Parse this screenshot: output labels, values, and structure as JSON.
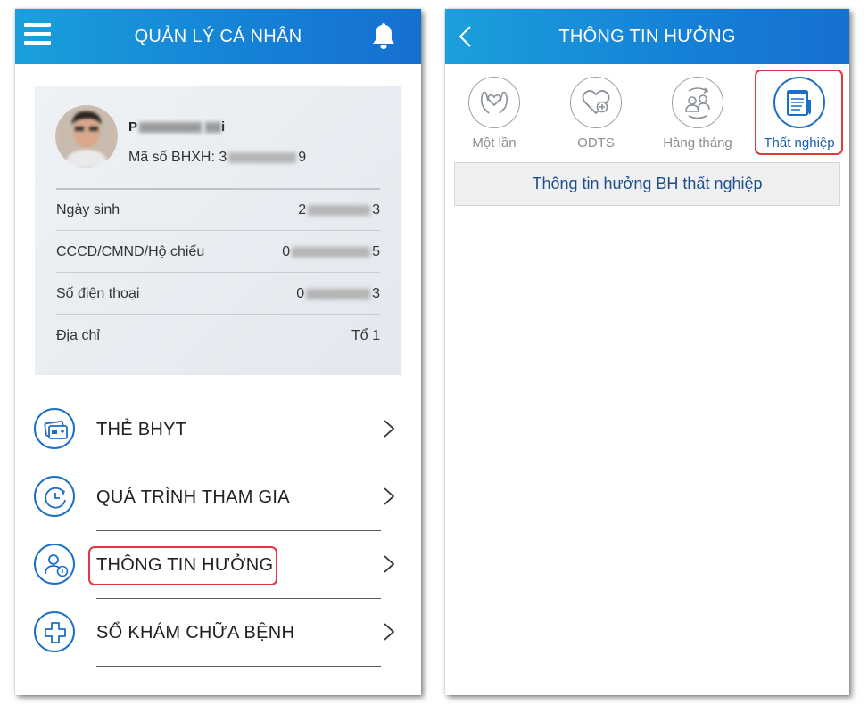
{
  "left_screen": {
    "header": {
      "title": "QUẢN LÝ CÁ NHÂN",
      "menu_icon": "hamburger-menu-icon",
      "notification_icon": "bell-icon"
    },
    "profile": {
      "name_visible": "P",
      "name_suffix_visible": "i",
      "bhxh_label": "Mã số BHXH: 3",
      "bhxh_suffix": "9",
      "rows": [
        {
          "label": "Ngày sinh",
          "value_prefix": "2",
          "value_suffix": "3"
        },
        {
          "label": "CCCD/CMND/Hộ chiếu",
          "value_prefix": "0",
          "value_suffix": "5"
        },
        {
          "label": "Số điện thoại",
          "value_prefix": "0",
          "value_suffix": "3"
        },
        {
          "label": "Địa chỉ",
          "value_prefix": "",
          "value_suffix": "Tổ 1"
        }
      ]
    },
    "menu": [
      {
        "label": "THẺ BHYT",
        "icon": "health-card-icon"
      },
      {
        "label": "QUÁ TRÌNH THAM GIA",
        "icon": "history-clock-icon"
      },
      {
        "label": "THÔNG TIN HƯỞNG",
        "icon": "user-info-icon"
      },
      {
        "label": "SỔ KHÁM CHỮA BỆNH",
        "icon": "medical-cross-icon"
      }
    ]
  },
  "right_screen": {
    "header": {
      "title": "THÔNG TIN HƯỞNG",
      "back_icon": "chevron-left-icon"
    },
    "tabs": [
      {
        "label": "Một lần",
        "icon": "helping-hands-icon"
      },
      {
        "label": "ODTS",
        "icon": "heart-plus-icon"
      },
      {
        "label": "Hàng tháng",
        "icon": "people-cycle-icon"
      },
      {
        "label": "Thất nghiệp",
        "icon": "document-pen-icon"
      }
    ],
    "active_tab": "Thất nghiệp",
    "section_title": "Thông tin hưởng BH thất nghiệp"
  },
  "colors": {
    "header_start": "#1aa0dc",
    "header_end": "#1670d0",
    "accent": "#1a6fc6",
    "highlight": "#e0383e"
  }
}
